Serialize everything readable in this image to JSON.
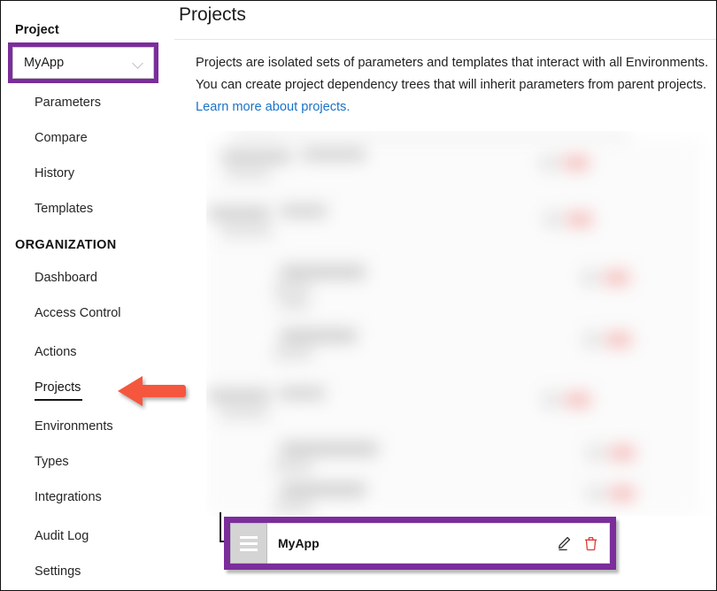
{
  "sidebar": {
    "project_section": {
      "heading": "Project",
      "select": {
        "value": "MyApp",
        "chevron_icon": "chevron-down-icon"
      },
      "items": [
        {
          "label": "Parameters",
          "active": false
        },
        {
          "label": "Compare",
          "active": false
        },
        {
          "label": "History",
          "active": false
        },
        {
          "label": "Templates",
          "active": false
        }
      ]
    },
    "organization_section": {
      "heading": "ORGANIZATION",
      "items": [
        {
          "label": "Dashboard",
          "active": false
        },
        {
          "label": "Access Control",
          "active": false
        },
        {
          "label": "Actions",
          "active": false
        },
        {
          "label": "Projects",
          "active": true
        },
        {
          "label": "Environments",
          "active": false
        },
        {
          "label": "Types",
          "active": false
        },
        {
          "label": "Integrations",
          "active": false
        },
        {
          "label": "Audit Log",
          "active": false
        },
        {
          "label": "Settings",
          "active": false
        }
      ]
    }
  },
  "main": {
    "title": "Projects",
    "description_text": "Projects are isolated sets of parameters and templates that interact with all Environments. You can create project dependency trees that will inherit parameters from parent projects. ",
    "description_link": "Learn more about projects."
  },
  "project_card": {
    "drag_handle_icon": "hamburger-drag-handle-icon",
    "name": "MyApp",
    "edit_icon": "pencil-edit-icon",
    "delete_icon": "trash-delete-icon"
  },
  "annotations": {
    "arrow": {
      "icon": "left-pointing-arrow-annotation",
      "color": "#F4573D",
      "points_to": "Projects"
    },
    "highlight_color": "#7B2D9B",
    "highlighted_elements": [
      "project-select",
      "project-card"
    ]
  },
  "colors": {
    "annotation_purple": "#7B2D9B",
    "annotation_red": "#F4573D",
    "link_blue": "#1A73C8",
    "delete_red": "#E03A35",
    "text_primary": "#1B1B1B"
  }
}
